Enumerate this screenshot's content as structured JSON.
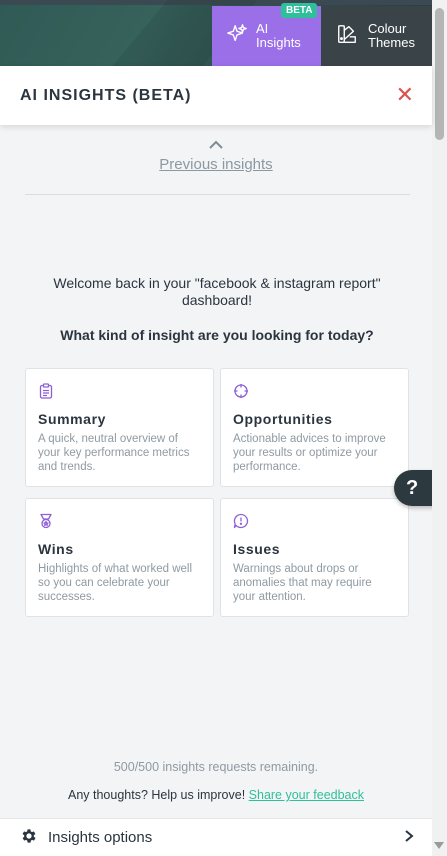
{
  "top_tabs": {
    "ai_insights": {
      "label_line1": "AI",
      "label_line2": "Insights",
      "badge": "BETA"
    },
    "colour_themes": {
      "label_line1": "Colour",
      "label_line2": "Themes"
    }
  },
  "panel": {
    "title": "AI INSIGHTS (BETA)",
    "previous_insights": "Previous insights",
    "welcome": "Welcome back in your \"facebook & instagram report\" dashboard!",
    "question": "What kind of insight are you looking for today?",
    "cards": [
      {
        "title": "Summary",
        "description": "A quick, neutral overview of your key performance metrics and trends.",
        "icon": "clipboard-icon"
      },
      {
        "title": "Opportunities",
        "description": "Actionable advices to improve your results or optimize your performance.",
        "icon": "crosshair-icon"
      },
      {
        "title": "Wins",
        "description": "Highlights of what worked well so you can celebrate your successes.",
        "icon": "medal-icon"
      },
      {
        "title": "Issues",
        "description": "Warnings about drops or anomalies that may require your attention.",
        "icon": "alert-bubble-icon"
      }
    ],
    "remaining": "500/500 insights requests remaining.",
    "feedback_text": "Any thoughts? Help us improve!",
    "feedback_link": "Share your feedback",
    "options_label": "Insights options"
  },
  "help_label": "?",
  "colors": {
    "accent_purple": "#9b6fe8",
    "beta_green": "#2fbf9b",
    "close_red": "#d9534f",
    "dark": "#2c3a40"
  }
}
